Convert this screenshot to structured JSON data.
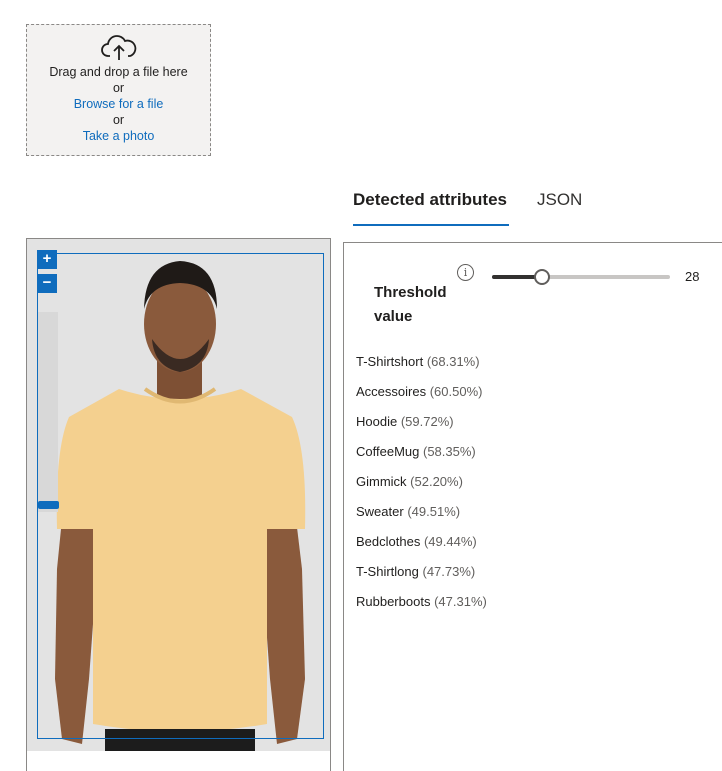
{
  "upload": {
    "icon": "cloud-upload-icon",
    "drag_text": "Drag and drop a file here",
    "or_1": "or",
    "browse_label": "Browse for a file",
    "or_2": "or",
    "photo_label": "Take a photo"
  },
  "tabs": [
    {
      "label": "Detected attributes",
      "active": true
    },
    {
      "label": "JSON",
      "active": false
    }
  ],
  "image_viewer": {
    "zoom_in_label": "+",
    "zoom_out_label": "−"
  },
  "threshold": {
    "label_line1": "Threshold",
    "label_line2": "value",
    "info_glyph": "i",
    "value": 28,
    "value_text": "28",
    "min": 0,
    "max": 100
  },
  "attributes": [
    {
      "name": "T-Shirtshort",
      "score": "(68.31%)"
    },
    {
      "name": "Accessoires",
      "score": "(60.50%)"
    },
    {
      "name": "Hoodie",
      "score": "(59.72%)"
    },
    {
      "name": "CoffeeMug",
      "score": "(58.35%)"
    },
    {
      "name": "Gimmick",
      "score": "(52.20%)"
    },
    {
      "name": "Sweater",
      "score": "(49.51%)"
    },
    {
      "name": "Bedclothes",
      "score": "(49.44%)"
    },
    {
      "name": "T-Shirtlong",
      "score": "(47.73%)"
    },
    {
      "name": "Rubberboots",
      "score": "(47.31%)"
    }
  ],
  "colors": {
    "accent": "#0f6cbd",
    "shirt": "#f4d08f",
    "skin": "#8a5a3c"
  }
}
